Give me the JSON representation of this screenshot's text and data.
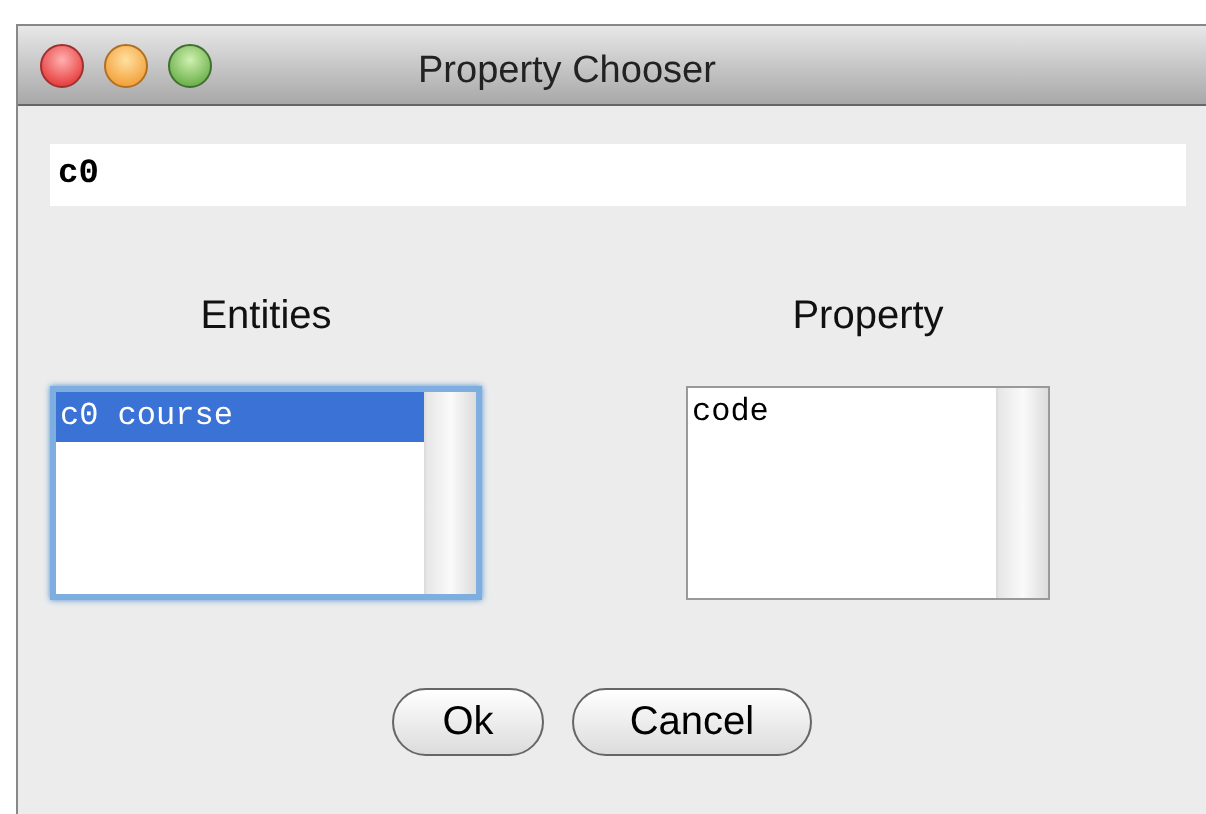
{
  "window": {
    "title": "Property Chooser"
  },
  "search": {
    "value": "c0"
  },
  "lists": [
    {
      "heading": "Entities",
      "focused": true,
      "items": [
        {
          "label": "c0 course",
          "selected": true
        }
      ]
    },
    {
      "heading": "Property",
      "focused": false,
      "items": [
        {
          "label": "code",
          "selected": false
        }
      ]
    }
  ],
  "buttons": [
    "Ok",
    "Cancel"
  ]
}
